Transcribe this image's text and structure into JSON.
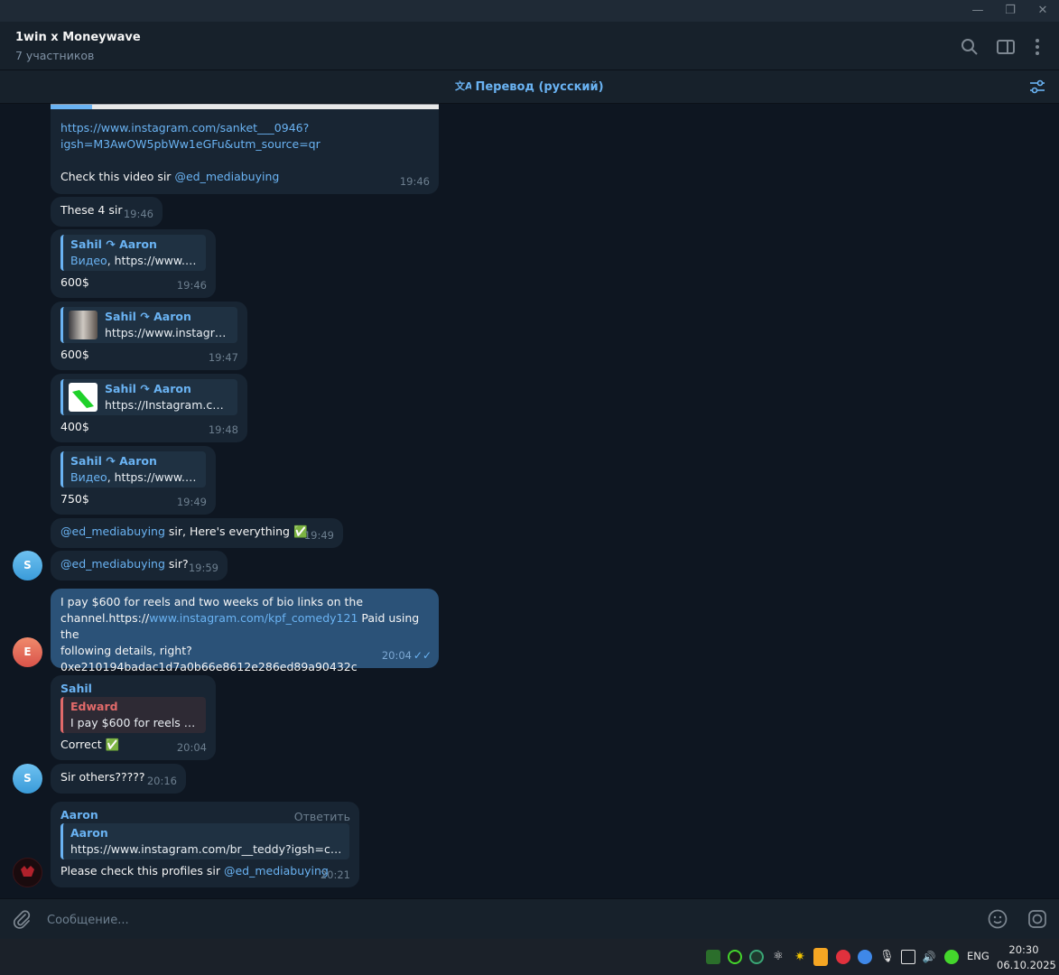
{
  "header": {
    "title": "1win x Moneywave",
    "subtitle": "7 участников"
  },
  "translate_bar": {
    "label": "Перевод (русский)"
  },
  "messages": [
    {
      "link": "https://www.instagram.com/sanket___0946?igsh=M3AwOW5pbWw1eGFu&utm_source=qr",
      "link_line1": "https://www.instagram.com/sanket___0946?",
      "link_line2": "igsh=M3AwOW5pbWw1eGFu&utm_source=qr",
      "text": "Check this video sir ",
      "mention": "@ed_mediabuying",
      "time": "19:46"
    },
    {
      "text": "These 4 sir",
      "time": "19:46"
    },
    {
      "reply_name": "Sahil ↷ Aaron",
      "reply_media": "Видео",
      "reply_text": ", https://www.in...",
      "text": "600$",
      "time": "19:46"
    },
    {
      "reply_name": "Sahil ↷ Aaron",
      "reply_text": "https://www.instagra...",
      "text": "600$",
      "time": "19:47"
    },
    {
      "reply_name": "Sahil ↷ Aaron",
      "reply_text": "https://Instagram.com...",
      "text": "400$",
      "time": "19:48"
    },
    {
      "reply_name": "Sahil ↷ Aaron",
      "reply_media": "Видео",
      "reply_text": ", https://www.in...",
      "text": "750$",
      "time": "19:49"
    },
    {
      "mention": "@ed_mediabuying",
      "text": " sir, Here's everything ✅",
      "time": "19:49"
    },
    {
      "mention": "@ed_mediabuying",
      "text": " sir?",
      "time": "19:59",
      "avatar": "S"
    },
    {
      "text_line1": "I pay $600 for reels and two weeks of bio links on the",
      "text_line2_a": "channel.https://",
      "text_line2_link": "www.instagram.com/kpf_comedy121",
      "text_line2_b": " Paid using the",
      "text_line3": "following details, right?",
      "text_line4": "0xe210194badac1d7a0b66e8612e286ed89a90432c",
      "time": "20:04",
      "avatar": "E"
    },
    {
      "sender": "Sahil",
      "reply_name": "Edward",
      "reply_text": "I pay $600 for reels an...",
      "text": "Correct ✅",
      "time": "20:04"
    },
    {
      "text": "Sir others?????",
      "time": "20:16",
      "avatar": "S"
    },
    {
      "sender": "Aaron",
      "action": "Ответить",
      "reply_name": "Aaron",
      "reply_text": "https://www.instagram.com/br__teddy?igsh=cTd...",
      "text": "Please check this profiles sir ",
      "mention": "@ed_mediabuying",
      "time": "20:21"
    }
  ],
  "composer": {
    "placeholder": "Сообщение..."
  },
  "taskbar": {
    "lang": "ENG",
    "time": "20:30",
    "date": "06.10.2025"
  },
  "colors": {
    "accent": "#6ab3f3",
    "bubble_in": "#182533",
    "bubble_out": "#2b5278",
    "background": "#0e1621"
  }
}
